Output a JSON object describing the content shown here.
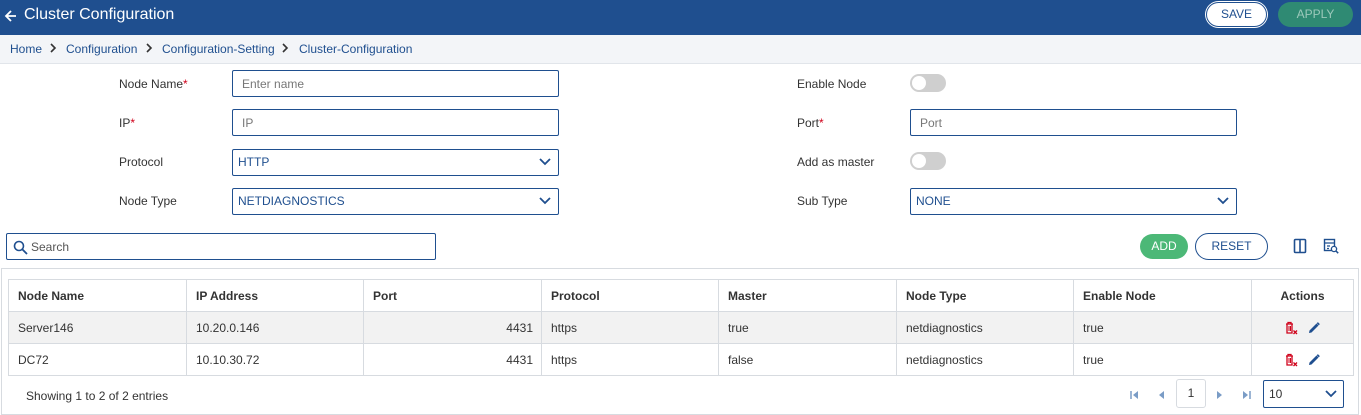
{
  "header": {
    "title": "Cluster Configuration",
    "save_label": "SAVE",
    "apply_label": "APPLY"
  },
  "breadcrumb": [
    "Home",
    "Configuration",
    "Configuration-Setting",
    "Cluster-Configuration"
  ],
  "form": {
    "node_name": {
      "label": "Node Name",
      "required_mark": "*",
      "placeholder": "Enter name",
      "value": ""
    },
    "ip": {
      "label": "IP",
      "required_mark": "*",
      "placeholder": "IP",
      "value": ""
    },
    "protocol": {
      "label": "Protocol",
      "value": "HTTP"
    },
    "node_type": {
      "label": "Node Type",
      "value": "NETDIAGNOSTICS"
    },
    "enable_node": {
      "label": "Enable Node",
      "on": false
    },
    "port": {
      "label": "Port",
      "required_mark": "*",
      "placeholder": "Port",
      "value": ""
    },
    "add_as_master": {
      "label": "Add as master",
      "on": false
    },
    "sub_type": {
      "label": "Sub Type",
      "value": "NONE"
    }
  },
  "toolbar": {
    "search_placeholder": "Search",
    "add_label": "ADD",
    "reset_label": "RESET"
  },
  "table": {
    "columns": [
      "Node Name",
      "IP Address",
      "Port",
      "Protocol",
      "Master",
      "Node Type",
      "Enable Node",
      "Actions"
    ],
    "rows": [
      {
        "node_name": "Server146",
        "ip": "10.20.0.146",
        "port": "4431",
        "protocol": "https",
        "master": "true",
        "node_type": "netdiagnostics",
        "enable": "true"
      },
      {
        "node_name": "DC72",
        "ip": "10.10.30.72",
        "port": "4431",
        "protocol": "https",
        "master": "false",
        "node_type": "netdiagnostics",
        "enable": "true"
      }
    ]
  },
  "footer": {
    "showing": "Showing 1 to 2 of 2 entries",
    "page": "1",
    "page_size": "10"
  },
  "colors": {
    "primary": "#1f4f8f",
    "add_green": "#4cb877",
    "apply_teal": "#2f8a73",
    "delete_red": "#d0021b"
  }
}
